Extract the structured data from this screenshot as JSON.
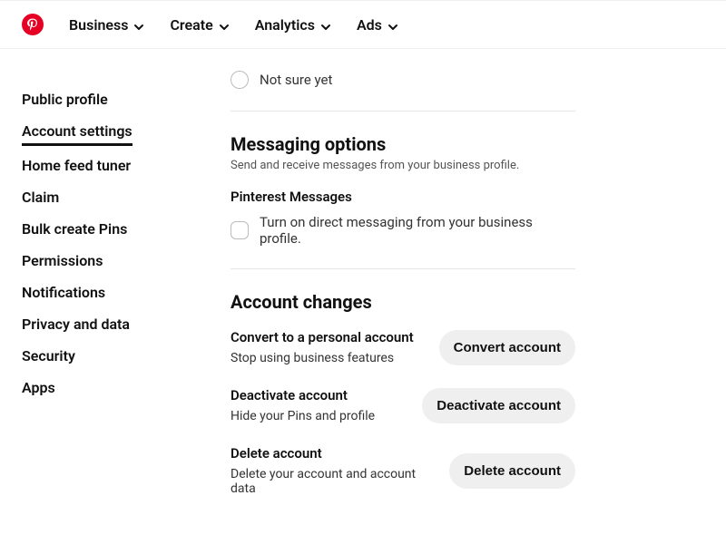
{
  "header": {
    "nav": [
      {
        "label": "Business"
      },
      {
        "label": "Create"
      },
      {
        "label": "Analytics"
      },
      {
        "label": "Ads"
      }
    ]
  },
  "sidebar": {
    "items": [
      {
        "label": "Public profile"
      },
      {
        "label": "Account settings"
      },
      {
        "label": "Home feed tuner"
      },
      {
        "label": "Claim"
      },
      {
        "label": "Bulk create Pins"
      },
      {
        "label": "Permissions"
      },
      {
        "label": "Notifications"
      },
      {
        "label": "Privacy and data"
      },
      {
        "label": "Security"
      },
      {
        "label": "Apps"
      }
    ]
  },
  "main": {
    "not_sure_label": "Not sure yet",
    "messaging": {
      "title": "Messaging options",
      "desc": "Send and receive messages from your business profile.",
      "sub_title": "Pinterest Messages",
      "checkbox_label": "Turn on direct messaging from your business profile."
    },
    "account_changes": {
      "title": "Account changes",
      "convert": {
        "title": "Convert to a personal account",
        "desc": "Stop using business features",
        "button": "Convert account"
      },
      "deactivate": {
        "title": "Deactivate account",
        "desc": "Hide your Pins and profile",
        "button": "Deactivate account"
      },
      "delete": {
        "title": "Delete account",
        "desc": "Delete your account and account data",
        "button": "Delete account"
      }
    }
  }
}
